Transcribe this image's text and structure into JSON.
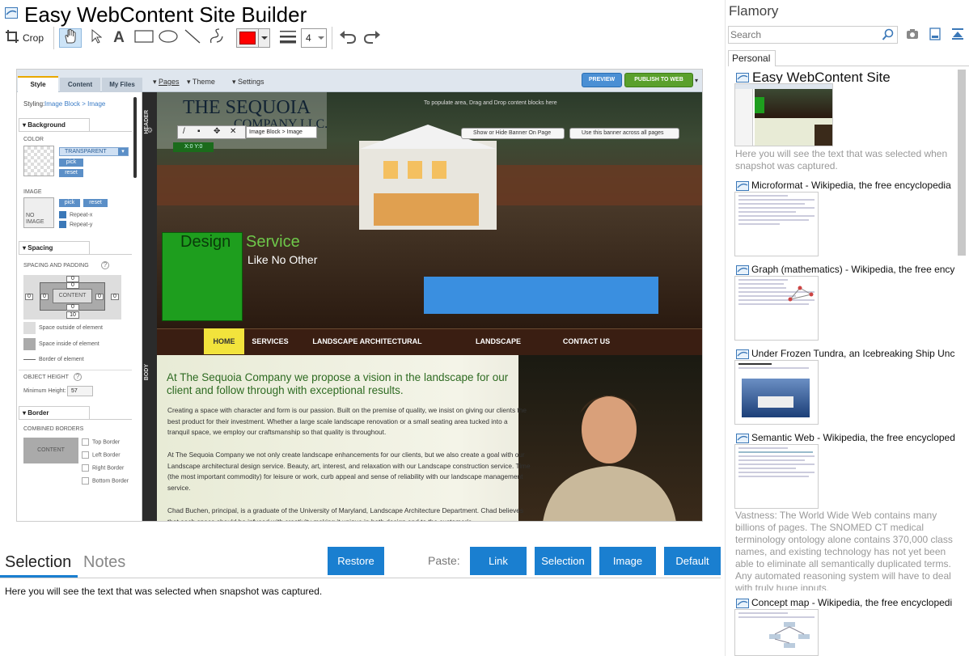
{
  "app": {
    "title": "Easy WebContent Site Builder",
    "crop_label": "Crop",
    "line_width": "4"
  },
  "colors": {
    "accent": "#1a7fd0",
    "swatch": "#ff0000",
    "site_green": "#1e9e1e",
    "site_menu": "#3a1e12"
  },
  "toolbar_icons": [
    "crop-icon",
    "hand-icon",
    "arrow-icon",
    "text-icon",
    "rectangle-icon",
    "ellipse-icon",
    "line-icon",
    "pen-icon",
    "color-swatch",
    "line-width-icon",
    "undo-icon",
    "redo-icon"
  ],
  "editor": {
    "tabs": [
      "Style",
      "Content",
      "My Files"
    ],
    "menu": [
      "Pages",
      "Theme",
      "Settings"
    ],
    "preview": "PREVIEW",
    "publish": "PUBLISH TO WEB",
    "styling_label": "Styling:",
    "styling_value": "Image Block > Image",
    "background": "Background",
    "color": "COLOR",
    "transparent": "TRANSPARENT",
    "pick": "pick",
    "reset": "reset",
    "image": "IMAGE",
    "no_image": "NO IMAGE",
    "repeat_x": "Repeat-x",
    "repeat_y": "Repeat-y",
    "spacing": "Spacing",
    "spacing_padding": "SPACING AND PADDING",
    "content_box": "CONTENT",
    "zero": "0",
    "ten": "10",
    "space_outside": "Space outside of element",
    "space_inside": "Space inside of element",
    "border_of": "Border of element",
    "object_height": "OBJECT HEIGHT",
    "min_height_label": "Minimum Height:",
    "min_height": "57",
    "border": "Border",
    "combined_borders": "COMBINED BORDERS",
    "border_opts": [
      "Top Border",
      "Left Border",
      "Right Border",
      "Bottom Border"
    ],
    "header_tag": "HEADER",
    "body_tag": "BODY",
    "block_path": "Image Block > Image",
    "coords": "X:0 Y:0",
    "show_hide_banner": "Show or Hide Banner On Page",
    "use_banner": "Use this banner across all pages",
    "hint": "To populate area, Drag and Drop content blocks here",
    "site": {
      "logo1": "THE SEQUOIA",
      "logo2": "COMPANY LLC.",
      "design": "Design",
      "service": "Service",
      "tagline": "Like No Other",
      "nav": [
        "HOME",
        "SERVICES",
        "LANDSCAPE ARCHITECTURAL DESIGN",
        "LANDSCAPE CONSTRUCTION",
        "CONTACT US"
      ],
      "headline": "At The Sequoia Company we propose a vision in the landscape for our client and follow through with exceptional results.",
      "p1": "Creating a space with character and form is our passion. Built on the premise of quality, we insist on giving our clients the best product for their investment. Whether a large scale landscape renovation or a small seating area tucked into a tranquil space, we employ our craftsmanship so that quality is throughout.",
      "p2": "At The Sequoia Company we not only create landscape enhancements for our clients, but we also create a goal with our Landscape architectural design service. Beauty, art, interest, and relaxation with our Landscape construction service. Time (the most important commodity) for leisure or work, curb appeal and sense of reliability with our landscape management service.",
      "p3": "Chad Buchen, principal, is a graduate of the University of Maryland, Landscape Architecture Department. Chad believes that each space should be infused with creativity making it unique in both design and to the customer's"
    }
  },
  "bottom": {
    "tab_selection": "Selection",
    "tab_notes": "Notes",
    "restore": "Restore",
    "paste": "Paste:",
    "link": "Link",
    "selection": "Selection",
    "image": "Image",
    "default": "Default",
    "text": "Here you will see the text that was selected when snapshot was captured."
  },
  "sidebar": {
    "title": "Flamory",
    "search_placeholder": "Search",
    "tab": "Personal",
    "items": [
      {
        "title": "Easy WebContent Site",
        "desc": "Here you will see the text that was selected when snapshot was captured."
      },
      {
        "title": "Microformat - Wikipedia, the free encyclopedia"
      },
      {
        "title": "Graph (mathematics) - Wikipedia, the free ency"
      },
      {
        "title": "Under Frozen Tundra, an Icebreaking Ship Unco"
      },
      {
        "title": "Semantic Web - Wikipedia, the free encycloped",
        "desc": "Vastness: The World Wide Web contains many billions of pages. The SNOMED CT medical terminology ontology alone contains 370,000 class names, and existing technology has not yet been able to eliminate all semantically duplicated terms. Any automated reasoning system will have to deal with truly huge inputs."
      },
      {
        "title": "Concept map - Wikipedia, the free encyclopedi"
      }
    ]
  }
}
